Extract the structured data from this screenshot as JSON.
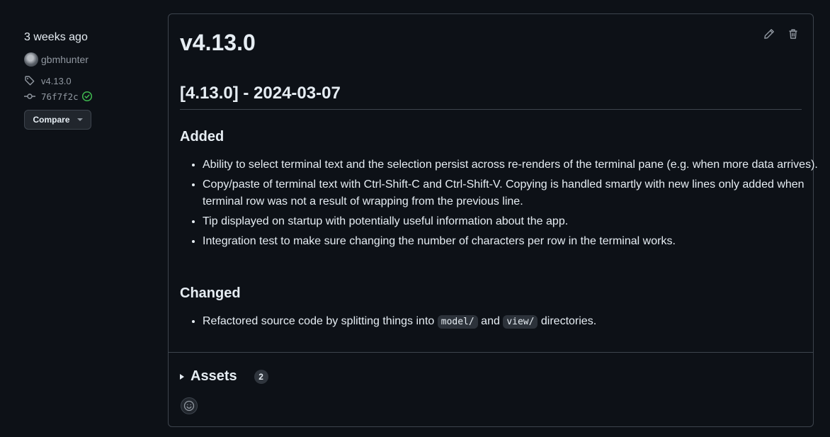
{
  "sidebar": {
    "time": "3 weeks ago",
    "author": "gbmhunter",
    "tag": "v4.13.0",
    "commit": "76f7f2c",
    "compare_label": "Compare"
  },
  "release": {
    "title": "v4.13.0",
    "heading": "[4.13.0] - 2024-03-07",
    "added_heading": "Added",
    "added_items": [
      "Ability to select terminal text and the selection persist across re-renders of the terminal pane (e.g. when more data arrives).",
      "Copy/paste of terminal text with Ctrl-Shift-C and Ctrl-Shift-V. Copying is handled smartly with new lines only added when terminal row was not a result of wrapping from the previous line.",
      "Tip displayed on startup with potentially useful information about the app.",
      "Integration test to make sure changing the number of characters per row in the terminal works."
    ],
    "changed_heading": "Changed",
    "changed_item": {
      "before": "Refactored source code by splitting things into ",
      "code1": "model/",
      "middle": " and ",
      "code2": "view/",
      "after": " directories."
    }
  },
  "assets": {
    "label": "Assets",
    "count": "2"
  },
  "icons": {
    "edit": "pencil-icon",
    "delete": "trash-icon",
    "tag": "tag-icon",
    "commit": "git-commit-icon",
    "verified": "check-circle-icon",
    "reaction": "smiley-icon"
  },
  "colors": {
    "background": "#0d1117",
    "border": "#3d444d",
    "text": "#e6edf3",
    "muted": "#9198a1",
    "success": "#3fb950"
  }
}
